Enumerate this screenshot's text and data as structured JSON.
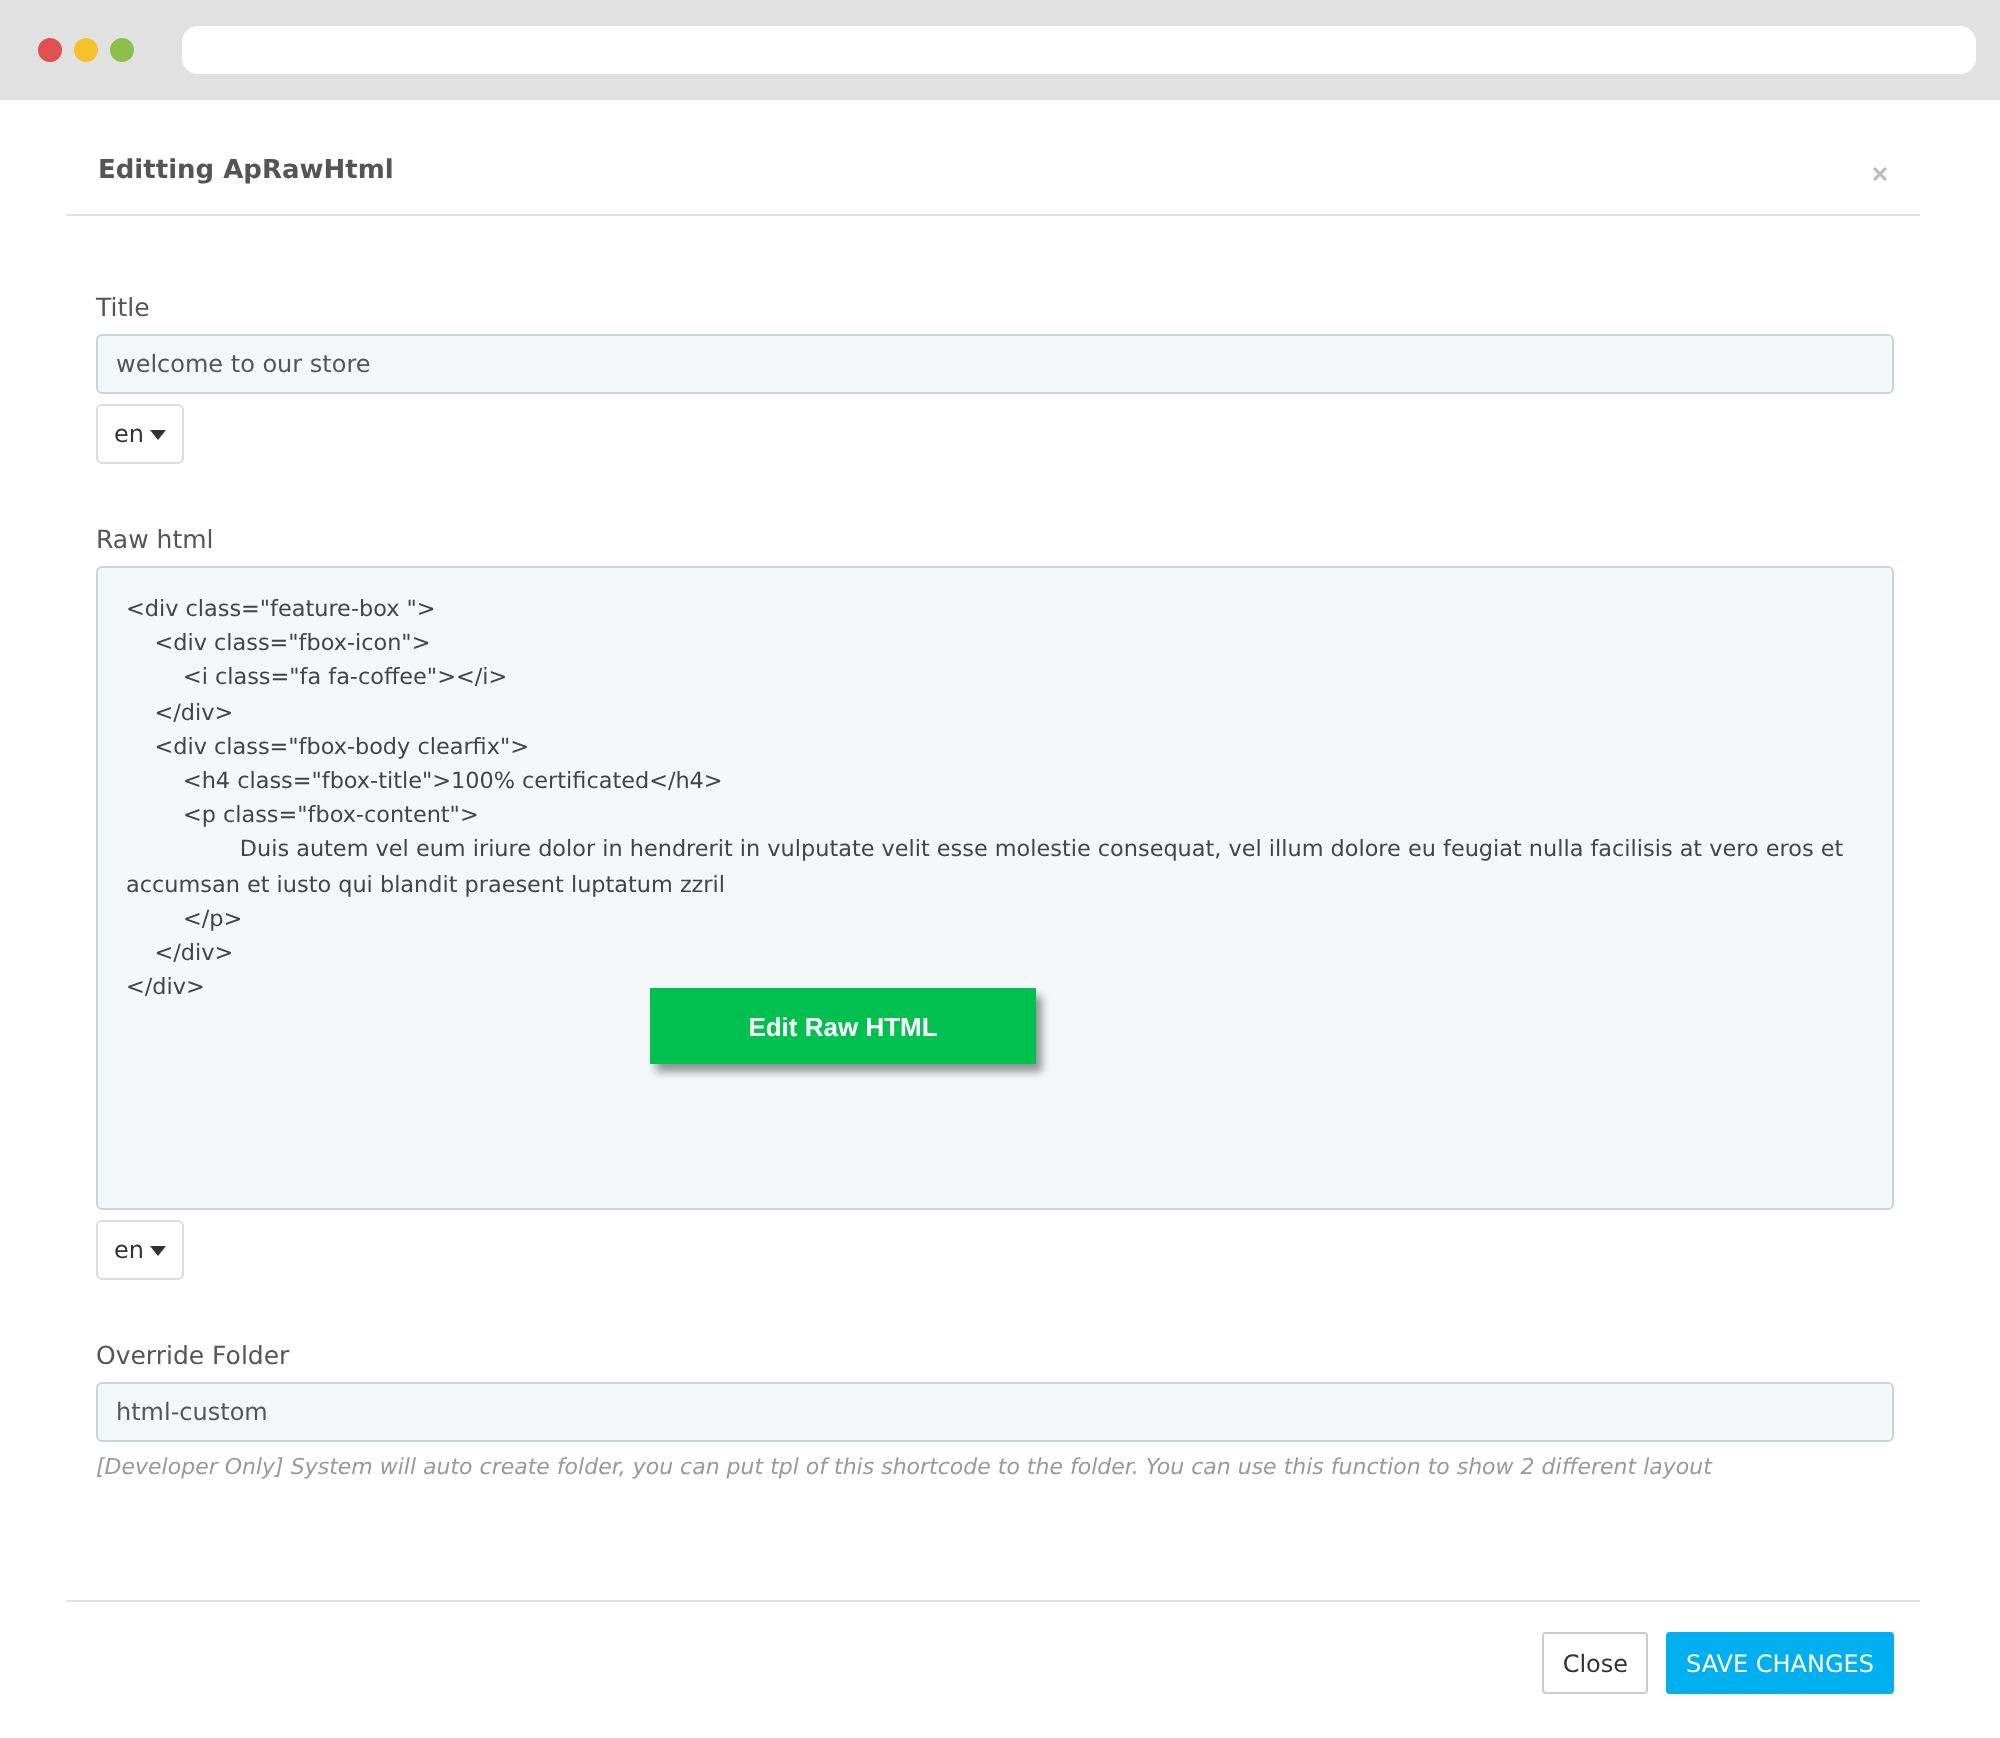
{
  "window": {
    "title": "Editting ApRawHtml"
  },
  "fields": [
    {
      "kind": "input",
      "label": "Title",
      "value": "welcome to our store",
      "language": "en"
    },
    {
      "kind": "textarea",
      "label": "Raw html",
      "value": "<div class=\"feature-box \">\n    <div class=\"fbox-icon\">\n        <i class=\"fa fa-coffee\"></i>\n    </div>\n    <div class=\"fbox-body clearfix\">\n        <h4 class=\"fbox-title\">100% certificated</h4>\n        <p class=\"fbox-content\">\n                Duis autem vel eum iriure dolor in hendrerit in vulputate velit esse molestie consequat, vel illum dolore eu feugiat nulla facilisis at vero eros et accumsan et iusto qui blandit praesent luptatum zzril\n        </p>\n    </div>\n</div>",
      "overlay_button": "Edit Raw HTML",
      "language": "en"
    },
    {
      "kind": "input",
      "label": "Override Folder",
      "value": "html-custom",
      "help": "[Developer Only] System will auto create folder, you can put tpl of this shortcode to the folder. You can use this function to show 2 different layout"
    }
  ],
  "buttons": [
    {
      "label": "Close",
      "kind": "default"
    },
    {
      "label": "SAVE CHANGES",
      "kind": "primary"
    }
  ]
}
